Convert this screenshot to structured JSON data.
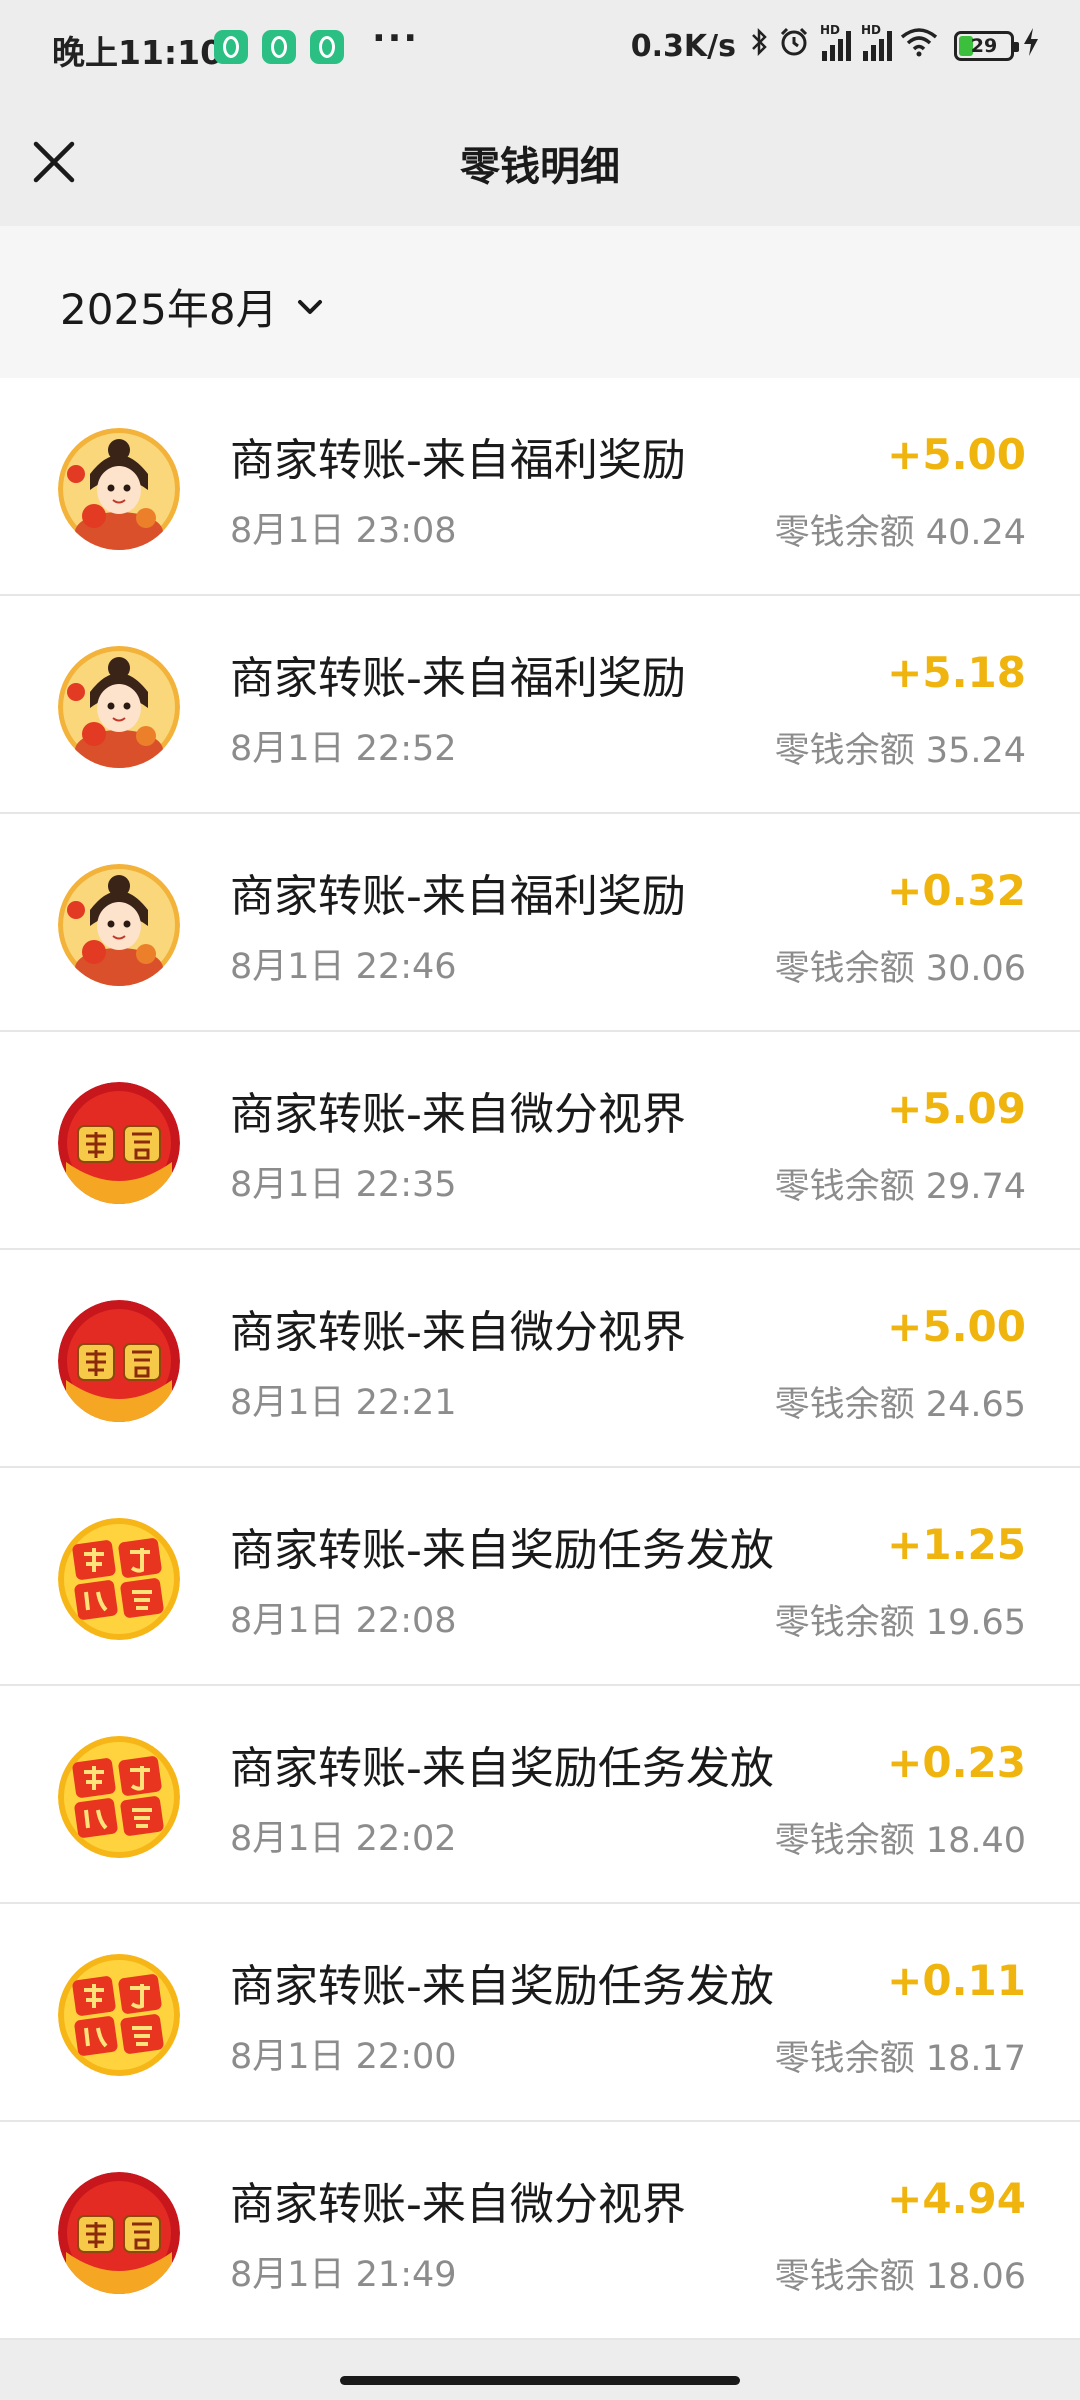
{
  "status_bar": {
    "time": "晚上11:10",
    "more": "···",
    "net_speed": "0.3K/s",
    "bluetooth_icon": "bluetooth-icon",
    "alarm_icon": "alarm-icon",
    "signal_label": "HD",
    "battery_level": "29",
    "charging_icon": "charging-bolt-icon"
  },
  "header": {
    "title": "零钱明细",
    "close_icon": "close-icon"
  },
  "filter": {
    "month": "2025年8月",
    "dropdown_icon": "chevron-down-icon"
  },
  "colors": {
    "amount": "#f0b40f",
    "secondary_text": "#8c8c8c",
    "background": "#ededed"
  },
  "transactions": [
    {
      "title": "商家转账-来自福利奖励",
      "time": "8月1日 23:08",
      "amount": "+5.00",
      "balance": "零钱余额 40.24",
      "avatar": "cartoon-girl-avatar"
    },
    {
      "title": "商家转账-来自福利奖励",
      "time": "8月1日 22:52",
      "amount": "+5.18",
      "balance": "零钱余额 35.24",
      "avatar": "cartoon-girl-avatar"
    },
    {
      "title": "商家转账-来自福利奖励",
      "time": "8月1日 22:46",
      "amount": "+0.32",
      "balance": "零钱余额 30.06",
      "avatar": "cartoon-girl-avatar"
    },
    {
      "title": "商家转账-来自微分视界",
      "time": "8月1日 22:35",
      "amount": "+5.09",
      "balance": "零钱余额 29.74",
      "avatar": "baofu-avatar",
      "avatar_text": "暴富"
    },
    {
      "title": "商家转账-来自微分视界",
      "time": "8月1日 22:21",
      "amount": "+5.00",
      "balance": "零钱余额 24.65",
      "avatar": "baofu-avatar",
      "avatar_text": "暴富"
    },
    {
      "title": "商家转账-来自奖励任务发放",
      "time": "8月1日 22:08",
      "amount": "+1.25",
      "balance": "零钱余额 19.65",
      "avatar": "quanliyifu-avatar",
      "avatar_text": "全力以富"
    },
    {
      "title": "商家转账-来自奖励任务发放",
      "time": "8月1日 22:02",
      "amount": "+0.23",
      "balance": "零钱余额 18.40",
      "avatar": "quanliyifu-avatar",
      "avatar_text": "全力以富"
    },
    {
      "title": "商家转账-来自奖励任务发放",
      "time": "8月1日 22:00",
      "amount": "+0.11",
      "balance": "零钱余额 18.17",
      "avatar": "quanliyifu-avatar",
      "avatar_text": "全力以富"
    },
    {
      "title": "商家转账-来自微分视界",
      "time": "8月1日 21:49",
      "amount": "+4.94",
      "balance": "零钱余额 18.06",
      "avatar": "baofu-avatar",
      "avatar_text": "暴富"
    }
  ]
}
